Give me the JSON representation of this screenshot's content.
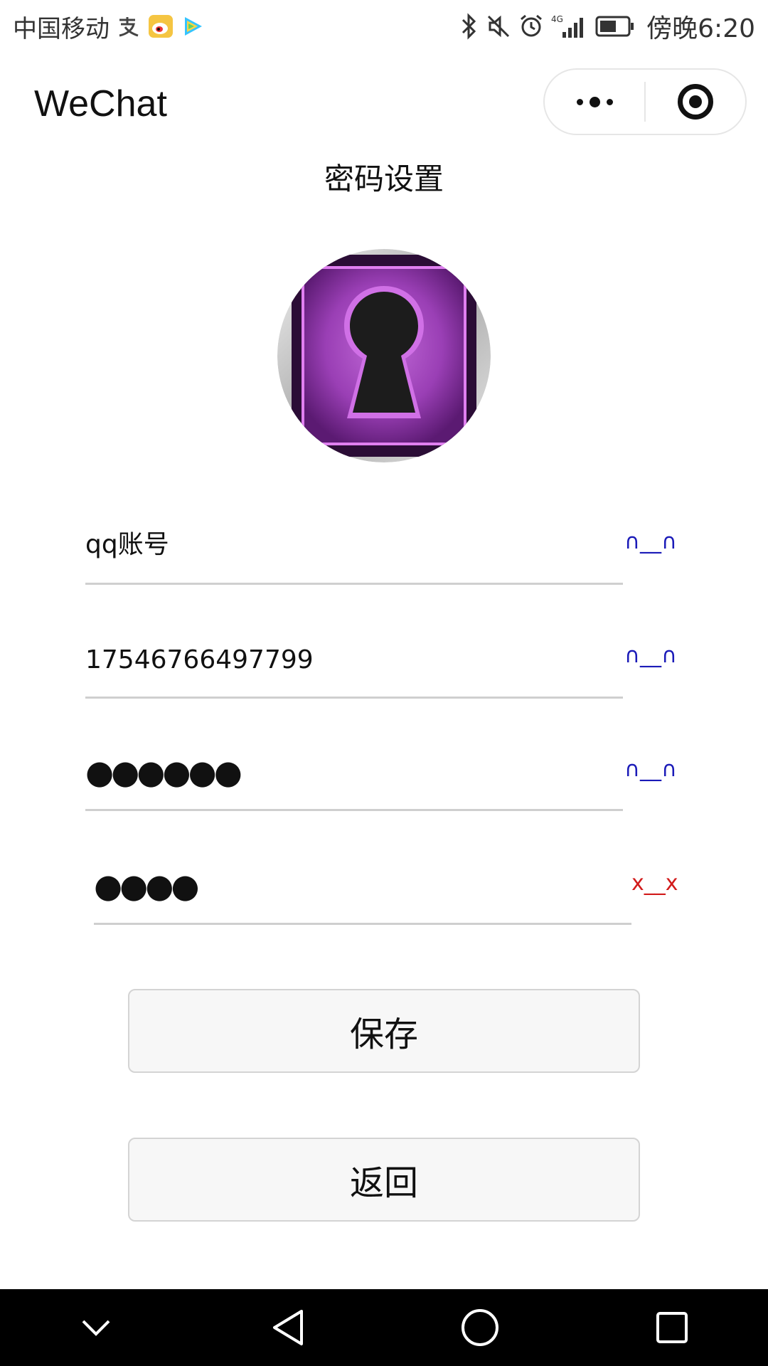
{
  "status_bar": {
    "carrier": "中国移动",
    "network": "4G",
    "time": "傍晚6:20"
  },
  "title_bar": {
    "title": "WeChat",
    "more_icon": "more-dots-icon",
    "close_icon": "target-circle-icon"
  },
  "page": {
    "heading": "密码设置",
    "avatar_icon": "keyhole-lock-icon"
  },
  "form": {
    "fields": [
      {
        "value": "qq账号",
        "status": "∩__∩"
      },
      {
        "value": "17546766497799",
        "status": "∩__∩"
      },
      {
        "value": "●●●●●●",
        "status": "∩__∩"
      },
      {
        "value": "●●●●",
        "status": "x__x"
      }
    ]
  },
  "buttons": {
    "save": "保存",
    "back": "返回"
  },
  "colors": {
    "ok_status": "#1a1ab8",
    "error_status": "#d21b1b",
    "nav_bar": "#000000"
  },
  "nav": {
    "icons": [
      "chevron-down-icon",
      "back-triangle-icon",
      "home-circle-icon",
      "recents-square-icon"
    ]
  }
}
